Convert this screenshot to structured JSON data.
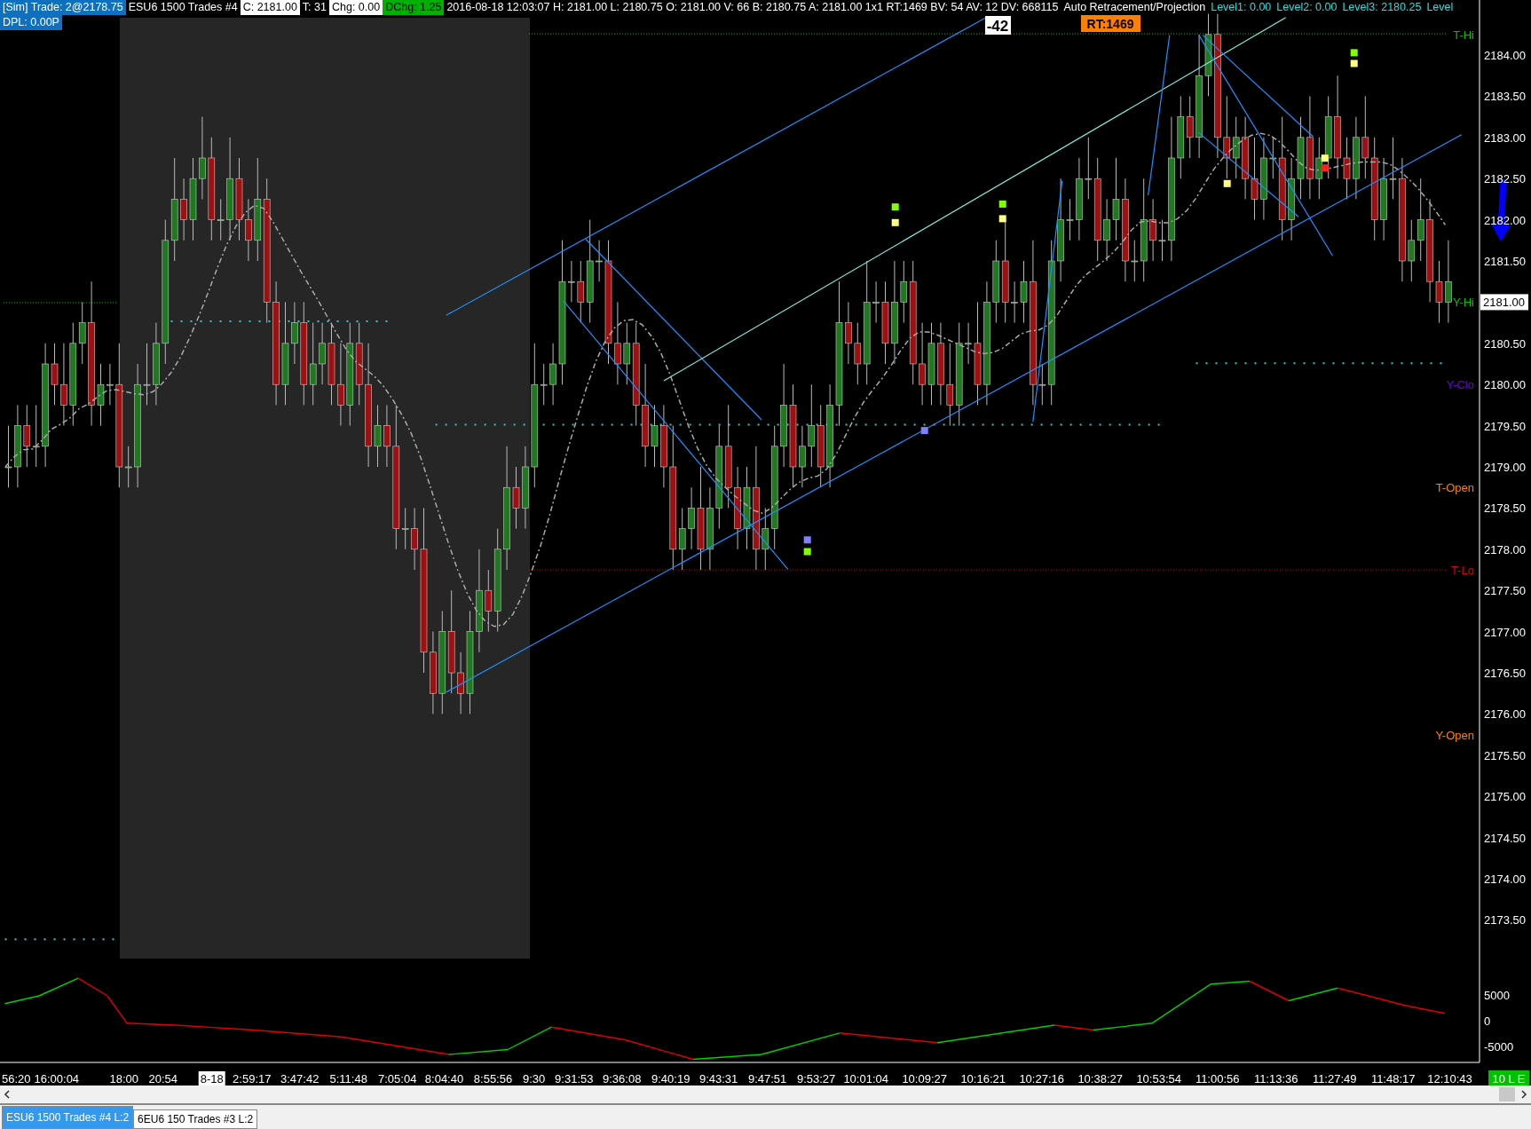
{
  "header": {
    "account": "[Sim]  Trade: 2@2178.75",
    "symbol": "ESU6   1500 Trades   #4",
    "close": "C: 2181.00",
    "trades": "T: 31",
    "change": "Chg: 0.00",
    "day_change": "DChg: 1.25",
    "info": "2016-08-18 12:03:07 H: 2181.00 L: 2180.75 O: 2181.00 V: 66 B: 2180.75 A: 2181.00 1x1 RT:1469 BV: 54 AV: 12 DV: 668115",
    "study": "Auto Retracement/Projection",
    "levels": [
      "Level1: 0.00",
      "Level2: 0.00",
      "Level3: 2180.25",
      "Level"
    ]
  },
  "dpl": "DPL: 0.00P",
  "markers": {
    "bar_count": "-42",
    "rt": "RT:1469"
  },
  "level_labels": [
    {
      "text": "T-Hi",
      "color": "#00c000"
    },
    {
      "text": "Y-Hi",
      "color": "#00c000"
    },
    {
      "text": "Y-Clo",
      "color": "#7000e0"
    },
    {
      "text": "T-Open",
      "color": "#ff8000"
    },
    {
      "text": "T-Lo",
      "color": "#e00000"
    },
    {
      "text": "Y-Open",
      "color": "#ff8000"
    }
  ],
  "price_axis": [
    {
      "text": "2184.00",
      "highlight": false
    },
    {
      "text": "2183.50",
      "highlight": false
    },
    {
      "text": "2183.00",
      "highlight": false
    },
    {
      "text": "2182.50",
      "highlight": false
    },
    {
      "text": "2182.00",
      "highlight": false
    },
    {
      "text": "2181.50",
      "highlight": false
    },
    {
      "text": "2181.00",
      "highlight": true
    },
    {
      "text": "2180.50",
      "highlight": false
    },
    {
      "text": "2180.00",
      "highlight": false
    },
    {
      "text": "2179.50",
      "highlight": false
    },
    {
      "text": "2179.00",
      "highlight": false
    },
    {
      "text": "2178.50",
      "highlight": false
    },
    {
      "text": "2178.00",
      "highlight": false
    },
    {
      "text": "2177.50",
      "highlight": false
    },
    {
      "text": "2177.00",
      "highlight": false
    },
    {
      "text": "2176.50",
      "highlight": false
    },
    {
      "text": "2176.00",
      "highlight": false
    },
    {
      "text": "2175.50",
      "highlight": false
    },
    {
      "text": "2175.00",
      "highlight": false
    },
    {
      "text": "2174.50",
      "highlight": false
    },
    {
      "text": "2174.00",
      "highlight": false
    },
    {
      "text": "2173.50",
      "highlight": false
    }
  ],
  "oscillator_axis": [
    "5000",
    "0",
    "-5000"
  ],
  "time_axis": [
    {
      "text": "56:20",
      "highlight": false
    },
    {
      "text": "16:00:04",
      "highlight": false
    },
    {
      "text": "18:00",
      "highlight": false
    },
    {
      "text": "20:54",
      "highlight": false
    },
    {
      "text": "8-18",
      "highlight": true
    },
    {
      "text": "2:59:17",
      "highlight": false
    },
    {
      "text": "3:47:42",
      "highlight": false
    },
    {
      "text": "5:11:48",
      "highlight": false
    },
    {
      "text": "7:05:04",
      "highlight": false
    },
    {
      "text": "8:04:40",
      "highlight": false
    },
    {
      "text": "8:55:56",
      "highlight": false
    },
    {
      "text": "9:30",
      "highlight": false
    },
    {
      "text": "9:31:53",
      "highlight": false
    },
    {
      "text": "9:36:08",
      "highlight": false
    },
    {
      "text": "9:40:19",
      "highlight": false
    },
    {
      "text": "9:43:31",
      "highlight": false
    },
    {
      "text": "9:47:51",
      "highlight": false
    },
    {
      "text": "9:53:27",
      "highlight": false
    },
    {
      "text": "10:01:04",
      "highlight": false
    },
    {
      "text": "10:09:27",
      "highlight": false
    },
    {
      "text": "10:16:21",
      "highlight": false
    },
    {
      "text": "10:27:16",
      "highlight": false
    },
    {
      "text": "10:38:27",
      "highlight": false
    },
    {
      "text": "10:53:54",
      "highlight": false
    },
    {
      "text": "11:00:56",
      "highlight": false
    },
    {
      "text": "11:13:36",
      "highlight": false
    },
    {
      "text": "11:27:49",
      "highlight": false
    },
    {
      "text": "11:48:17",
      "highlight": false
    },
    {
      "text": "12:10:43",
      "highlight": false
    }
  ],
  "status_badge": "10 L E",
  "tabs": [
    {
      "label": "ESU6  1500 Trades  #4  L:2",
      "selected": true
    },
    {
      "label": "6EU6  150 Trades  #3  L:2",
      "selected": false
    }
  ]
}
